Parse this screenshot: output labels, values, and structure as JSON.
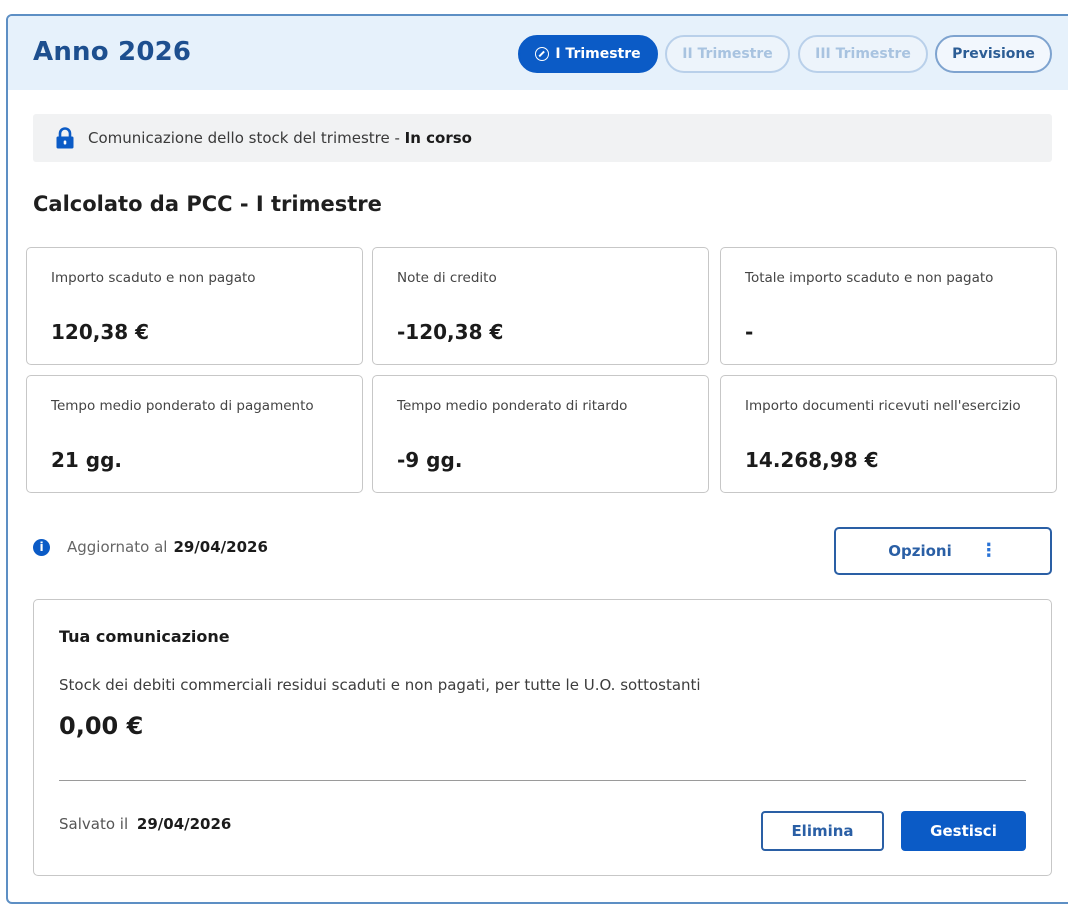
{
  "header": {
    "title": "Anno 2026",
    "tabs": [
      {
        "label": "I Trimestre",
        "state": "active",
        "icon": "check-circle-icon"
      },
      {
        "label": "II Trimestre",
        "state": "disabled"
      },
      {
        "label": "III Trimestre",
        "state": "disabled"
      },
      {
        "label": "Previsione",
        "state": "enabled"
      }
    ]
  },
  "status": {
    "icon": "lock-icon",
    "text": "Comunicazione dello stock del trimestre",
    "separator": " - ",
    "state": "In corso"
  },
  "section_title": "Calcolato da PCC - I trimestre",
  "cards": [
    {
      "label": "Importo scaduto e non pagato",
      "value": "120,38 €"
    },
    {
      "label": "Note di credito",
      "value": "-120,38 €"
    },
    {
      "label": "Totale importo scaduto e non pagato",
      "value": "-"
    },
    {
      "label": "Tempo medio ponderato di pagamento",
      "value": "21 gg."
    },
    {
      "label": "Tempo medio ponderato di ritardo",
      "value": "-9 gg."
    },
    {
      "label": "Importo documenti ricevuti nell'esercizio",
      "value": "14.268,98 €"
    }
  ],
  "update_info": {
    "icon": "info-icon",
    "label": "Aggiornato al",
    "date": "29/04/2026"
  },
  "options_button": {
    "label": "Opzioni",
    "icon": "kebab-menu-icon"
  },
  "communication": {
    "title": "Tua comunicazione",
    "description": "Stock dei debiti commerciali residui scaduti e non pagati, per tutte le U.O. sottostanti",
    "value": "0,00 €",
    "saved_label": "Salvato il",
    "saved_date": "29/04/2026",
    "delete_label": "Elimina",
    "manage_label": "Gestisci"
  },
  "colors": {
    "primary": "#0b5bc6",
    "header_bg": "#e6f1fb",
    "title_blue": "#1d4f8f",
    "disabled_tab": "#a8c3e0"
  }
}
